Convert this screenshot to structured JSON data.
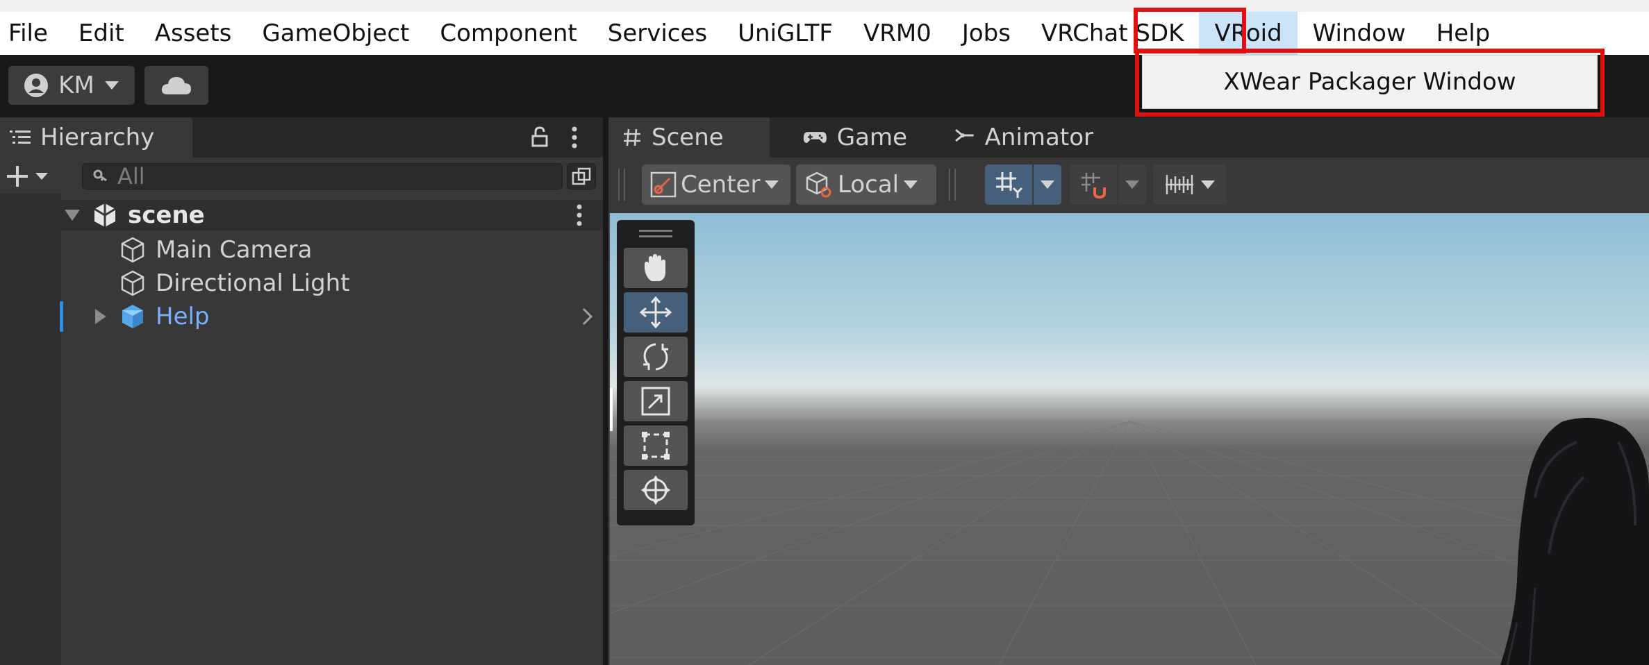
{
  "menubar": {
    "items": [
      "File",
      "Edit",
      "Assets",
      "GameObject",
      "Component",
      "Services",
      "UniGLTF",
      "VRM0",
      "Jobs",
      "VRChat SDK",
      "VRoid",
      "Window",
      "Help"
    ],
    "open_menu": "VRoid"
  },
  "dropdown": {
    "items": [
      "XWear Packager Window"
    ]
  },
  "toolbar": {
    "account_label": "KM"
  },
  "hierarchy": {
    "tab_label": "Hierarchy",
    "search_placeholder": "All",
    "scene_name": "scene",
    "items": [
      "Main Camera",
      "Directional Light",
      "Help"
    ]
  },
  "scene_view": {
    "tabs": [
      "Scene",
      "Game",
      "Animator"
    ],
    "pivot_mode": "Center",
    "pivot_rotation": "Local"
  },
  "colors": {
    "highlight_red": "#e01010",
    "selected_blue": "#7bb0ff",
    "active_tool_blue": "#46607c"
  }
}
